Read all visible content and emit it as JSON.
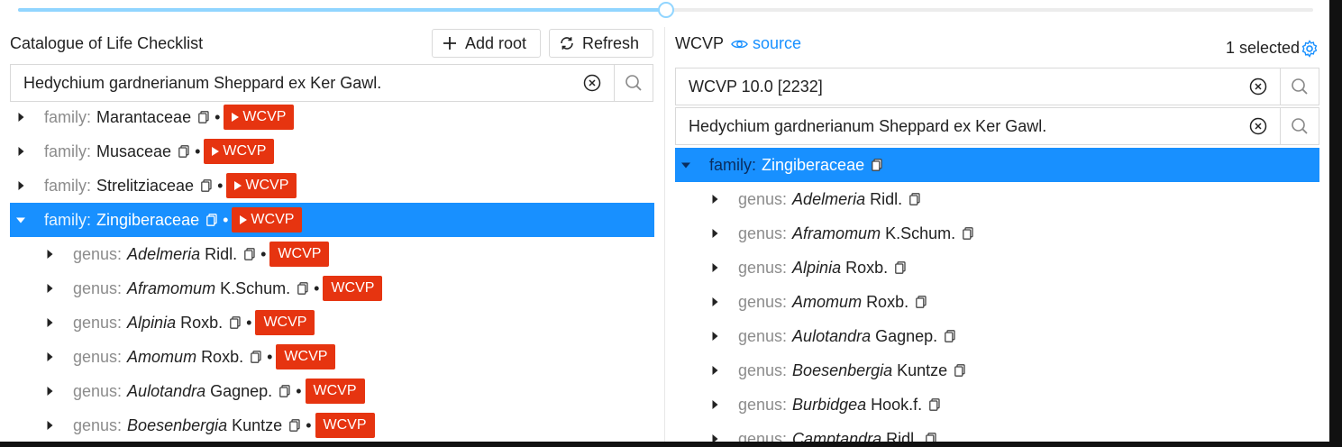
{
  "slider": {
    "value_fraction": 0.5
  },
  "left_panel": {
    "title": "Catalogue of Life Checklist",
    "add_root_label": "Add root",
    "refresh_label": "Refresh",
    "search_value": "Hedychium gardnerianum Sheppard ex Ker Gawl.",
    "rows": [
      {
        "rank": "family:",
        "name": "Marantaceae",
        "italic": "",
        "author": "",
        "tag": "WCVP",
        "tag_arrow": true,
        "selected": false,
        "expanded": false
      },
      {
        "rank": "family:",
        "name": "Musaceae",
        "italic": "",
        "author": "",
        "tag": "WCVP",
        "tag_arrow": true,
        "selected": false,
        "expanded": false
      },
      {
        "rank": "family:",
        "name": "Strelitziaceae",
        "italic": "",
        "author": "",
        "tag": "WCVP",
        "tag_arrow": true,
        "selected": false,
        "expanded": false
      },
      {
        "rank": "family:",
        "name": "Zingiberaceae",
        "italic": "",
        "author": "",
        "tag": "WCVP",
        "tag_arrow": true,
        "selected": true,
        "expanded": true
      },
      {
        "rank": "genus:",
        "name": "",
        "italic": "Adelmeria",
        "author": "Ridl.",
        "tag": "WCVP",
        "tag_arrow": false,
        "selected": false,
        "expanded": false
      },
      {
        "rank": "genus:",
        "name": "",
        "italic": "Aframomum",
        "author": "K.Schum.",
        "tag": "WCVP",
        "tag_arrow": false,
        "selected": false,
        "expanded": false
      },
      {
        "rank": "genus:",
        "name": "",
        "italic": "Alpinia",
        "author": "Roxb.",
        "tag": "WCVP",
        "tag_arrow": false,
        "selected": false,
        "expanded": false
      },
      {
        "rank": "genus:",
        "name": "",
        "italic": "Amomum",
        "author": "Roxb.",
        "tag": "WCVP",
        "tag_arrow": false,
        "selected": false,
        "expanded": false
      },
      {
        "rank": "genus:",
        "name": "",
        "italic": "Aulotandra",
        "author": "Gagnep.",
        "tag": "WCVP",
        "tag_arrow": false,
        "selected": false,
        "expanded": false
      },
      {
        "rank": "genus:",
        "name": "",
        "italic": "Boesenbergia",
        "author": "Kuntze",
        "tag": "WCVP",
        "tag_arrow": false,
        "selected": false,
        "expanded": false
      }
    ]
  },
  "right_panel": {
    "title": "WCVP",
    "source_label": "source",
    "selected_label": "1 selected",
    "dataset_value": "WCVP 10.0 [2232]",
    "search_value": "Hedychium gardnerianum Sheppard ex Ker Gawl.",
    "rows": [
      {
        "rank": "family:",
        "name": "Zingiberaceae",
        "italic": "",
        "author": "",
        "selected": true,
        "expanded": true
      },
      {
        "rank": "genus:",
        "name": "",
        "italic": "Adelmeria",
        "author": "Ridl.",
        "selected": false,
        "expanded": false
      },
      {
        "rank": "genus:",
        "name": "",
        "italic": "Aframomum",
        "author": "K.Schum.",
        "selected": false,
        "expanded": false
      },
      {
        "rank": "genus:",
        "name": "",
        "italic": "Alpinia",
        "author": "Roxb.",
        "selected": false,
        "expanded": false
      },
      {
        "rank": "genus:",
        "name": "",
        "italic": "Amomum",
        "author": "Roxb.",
        "selected": false,
        "expanded": false
      },
      {
        "rank": "genus:",
        "name": "",
        "italic": "Aulotandra",
        "author": "Gagnep.",
        "selected": false,
        "expanded": false
      },
      {
        "rank": "genus:",
        "name": "",
        "italic": "Boesenbergia",
        "author": "Kuntze",
        "selected": false,
        "expanded": false
      },
      {
        "rank": "genus:",
        "name": "",
        "italic": "Burbidgea",
        "author": "Hook.f.",
        "selected": false,
        "expanded": false
      },
      {
        "rank": "genus:",
        "name": "",
        "italic": "Camptandra",
        "author": "Ridl.",
        "selected": false,
        "expanded": false
      }
    ]
  },
  "colors": {
    "selection": "#1890ff",
    "tag": "#e63410",
    "link": "#1890ff",
    "slider": "#91d5ff"
  },
  "icons": [
    "plus-icon",
    "refresh-icon",
    "eye-icon",
    "gear-icon",
    "clear-icon",
    "search-icon",
    "caret-right-icon",
    "caret-down-icon",
    "copy-icon",
    "play-icon"
  ]
}
